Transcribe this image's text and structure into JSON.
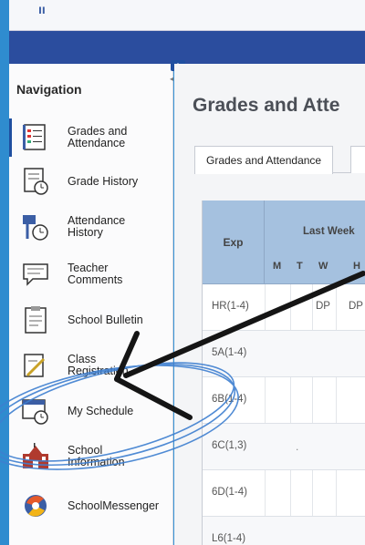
{
  "header": {
    "top_glyph": "ıı"
  },
  "sidebar": {
    "title": "Navigation",
    "items": [
      {
        "label": "Grades and Attendance",
        "icon": "gradebook-icon"
      },
      {
        "label": "Grade History",
        "icon": "grade-history-icon"
      },
      {
        "label": "Attendance History",
        "icon": "attendance-history-icon"
      },
      {
        "label": "Teacher Comments",
        "icon": "comments-icon"
      },
      {
        "label": "School Bulletin",
        "icon": "bulletin-icon"
      },
      {
        "label": "Class Registration",
        "icon": "registration-icon"
      },
      {
        "label": "My Schedule",
        "icon": "schedule-icon"
      },
      {
        "label": "School Information",
        "icon": "school-icon"
      },
      {
        "label": "SchoolMessenger",
        "icon": "messenger-icon"
      }
    ]
  },
  "main": {
    "page_title": "Grades and Atte",
    "tabs": [
      {
        "label": "Grades and Attendance"
      }
    ],
    "table": {
      "col_exp": "Exp",
      "col_week": "Last Week",
      "days": [
        "M",
        "T",
        "W",
        "H"
      ],
      "rows": [
        {
          "exp": "HR(1-4)",
          "w": "DP",
          "h": "DP"
        },
        {
          "exp": "5A(1-4)"
        },
        {
          "exp": "6B(1-4)"
        },
        {
          "exp": "6C(1,3)",
          "dot": "."
        },
        {
          "exp": "6D(1-4)"
        },
        {
          "exp": "L6(1-4)"
        }
      ]
    }
  },
  "colors": {
    "accent": "#2b4d9e",
    "frame": "#3a94d6",
    "table_header": "#a5c1df",
    "annotation": "#1a1a1a",
    "circle": "#3e7fd0"
  }
}
